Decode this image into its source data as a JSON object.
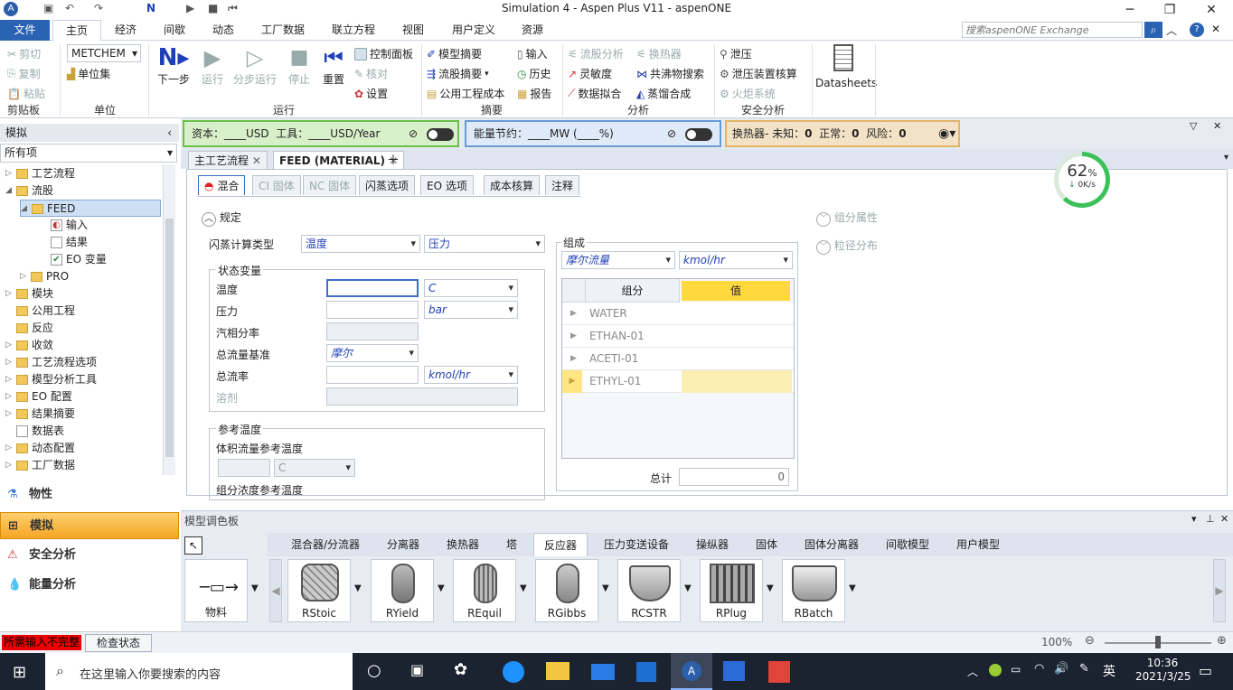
{
  "title": "Simulation 4 - Aspen Plus V11 - aspenONE",
  "menu": [
    "文件",
    "主页",
    "经济",
    "间歇",
    "动态",
    "工厂数据",
    "联立方程",
    "视图",
    "用户定义",
    "资源"
  ],
  "search_placeholder": "搜索aspenONE Exchange",
  "ribbon": {
    "clipboard": {
      "cut": "剪切",
      "copy": "复制",
      "paste": "粘贴",
      "group": "剪贴板"
    },
    "units": {
      "set": "METCHEM",
      "unitset": "单位集",
      "group": "单位"
    },
    "run": {
      "next": "下一步",
      "run": "运行",
      "step": "分步运行",
      "stop": "停止",
      "reset": "重置",
      "control": "控制面板",
      "check": "核对",
      "settings": "设置",
      "group": "运行"
    },
    "summary": {
      "model": "模型摘要",
      "stream": "流股摘要",
      "utility": "公用工程成本",
      "input": "输入",
      "history": "历史",
      "report": "报告",
      "group": "摘要"
    },
    "analysis": {
      "stream": "流股分析",
      "hx": "换热器",
      "sens": "灵敏度",
      "azeo": "共沸物搜索",
      "fit": "数据拟合",
      "dist": "蒸馏合成",
      "group": "分析"
    },
    "safety": {
      "relief": "泄压",
      "reliefcheck": "泄压装置核算",
      "flare": "火炬系统",
      "group": "安全分析"
    },
    "datasheets": "Datasheets"
  },
  "econ_bar": {
    "capital": "资本：____USD",
    "utility": "工具：____USD/Year",
    "energy": "能量节约：____MW   (____%)",
    "hx_label": "换热器- 未知：",
    "hx_unknown": "0",
    "ok_label": "正常：",
    "ok": "0",
    "risk_label": "风险：",
    "risk": "0"
  },
  "left": {
    "title": "模拟",
    "filter": "所有项",
    "tree": [
      "工艺流程",
      "流股",
      "FEED",
      "输入",
      "结果",
      "EO 变量",
      "PRO",
      "模块",
      "公用工程",
      "反应",
      "收敛",
      "工艺流程选项",
      "模型分析工具",
      "EO 配置",
      "结果摘要",
      "数据表",
      "动态配置",
      "工厂数据"
    ],
    "nav": [
      "物性",
      "模拟",
      "安全分析",
      "能量分析"
    ]
  },
  "doc_tabs": [
    "主工艺流程",
    "FEED (MATERIAL)"
  ],
  "form_tabs": [
    "混合",
    "CI 固体",
    "NC 固体",
    "闪蒸选项",
    "EO 选项",
    "成本核算",
    "注释"
  ],
  "form": {
    "spec": "规定",
    "flash_type": "闪蒸计算类型",
    "flash_a": "温度",
    "flash_b": "压力",
    "state_vars": "状态变量",
    "rows": [
      {
        "label": "温度",
        "value": "",
        "unit": "C"
      },
      {
        "label": "压力",
        "value": "",
        "unit": "bar"
      },
      {
        "label": "汽相分率",
        "value": "",
        "unit": ""
      },
      {
        "label": "总流量基准",
        "value": "摩尔",
        "unit": ""
      },
      {
        "label": "总流率",
        "value": "",
        "unit": "kmol/hr"
      },
      {
        "label": "溶剂",
        "value": "",
        "unit": ""
      }
    ],
    "ref_temp": "参考温度",
    "vol_ref": "体积流量参考温度",
    "vol_unit": "C",
    "comp_ref": "组分浓度参考温度",
    "composition": "组成",
    "comp_basis": "摩尔流量",
    "comp_unit": "kmol/hr",
    "comp_header": [
      "组分",
      "值"
    ],
    "components": [
      "WATER",
      "ETHAN-01",
      "ACETI-01",
      "ETHYL-01"
    ],
    "total_label": "总计",
    "total": "0",
    "comp_attr": "组分属性",
    "psd": "粒径分布"
  },
  "gauge": {
    "pct": "62",
    "unit": "%",
    "rate": "0K/s"
  },
  "palette": {
    "title": "模型调色板",
    "tabs": [
      "混合器/分流器",
      "分离器",
      "换热器",
      "塔",
      "反应器",
      "压力变送设备",
      "操纵器",
      "固体",
      "固体分离器",
      "间歇模型",
      "用户模型"
    ],
    "items": [
      "物料",
      "RStoic",
      "RYield",
      "REquil",
      "RGibbs",
      "RCSTR",
      "RPlug",
      "RBatch"
    ]
  },
  "status": {
    "msg": "所需输入不完整",
    "check": "检查状态",
    "zoom": "100%"
  },
  "taskbar": {
    "search": "在这里输入你要搜索的内容",
    "lang": "英",
    "time": "10:36",
    "date": "2021/3/25"
  }
}
